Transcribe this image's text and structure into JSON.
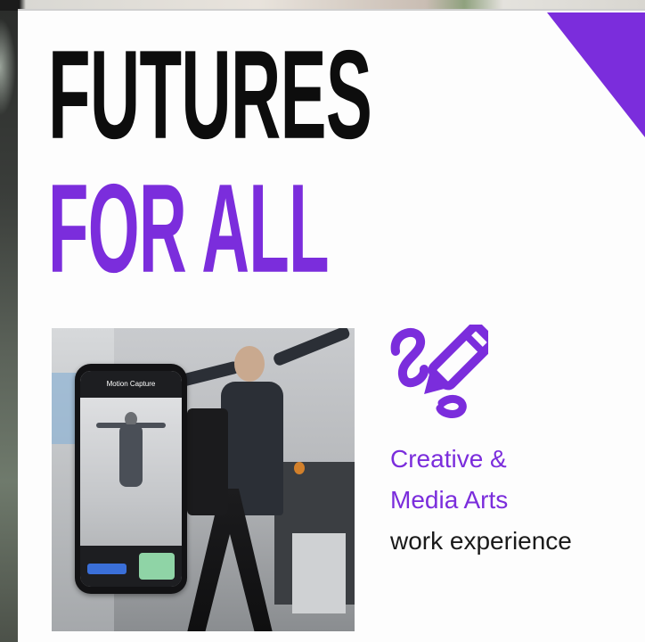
{
  "poster": {
    "headline_line_1": "FUTURES",
    "headline_line_2": "FOR ALL",
    "caption_line_1": "Creative &",
    "caption_line_2": "Media Arts",
    "caption_line_3": "work experience",
    "phone_screen_title": "Motion Capture"
  },
  "colors": {
    "brand_purple": "#7b2ddc",
    "headline_black": "#0d0d0d",
    "caption_dark": "#1a1a1a",
    "background": "#fdfdfd"
  },
  "icons": {
    "creative_icon": "pencil-with-scribble-icon",
    "corner_decoration": "purple-triangle"
  }
}
